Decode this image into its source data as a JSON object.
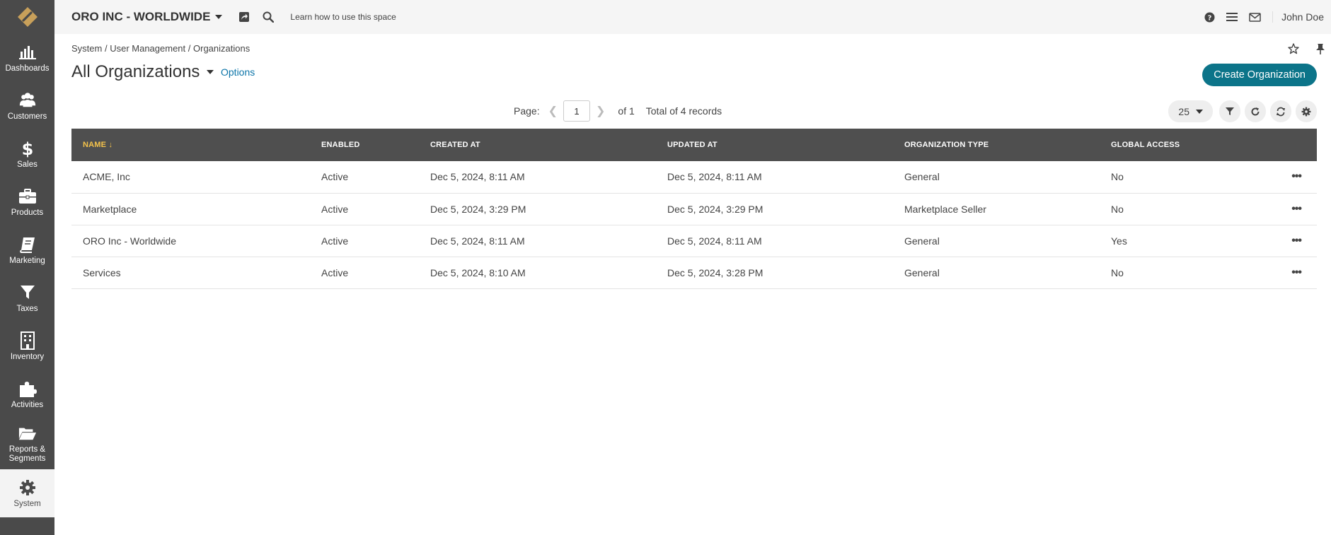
{
  "topbar": {
    "org_title": "ORO INC - WORLDWIDE",
    "learn_link": "Learn how to use this space",
    "user_name": "John Doe"
  },
  "sidebar": {
    "items": [
      {
        "label": "Dashboards",
        "icon": "bar-chart-icon"
      },
      {
        "label": "Customers",
        "icon": "users-icon"
      },
      {
        "label": "Sales",
        "icon": "dollar-icon"
      },
      {
        "label": "Products",
        "icon": "briefcase-icon"
      },
      {
        "label": "Marketing",
        "icon": "book-icon"
      },
      {
        "label": "Taxes",
        "icon": "filter-icon"
      },
      {
        "label": "Inventory",
        "icon": "building-icon"
      },
      {
        "label": "Activities",
        "icon": "puzzle-icon"
      },
      {
        "label": "Reports & Segments",
        "icon": "folder-open-icon"
      },
      {
        "label": "System",
        "icon": "gear-icon",
        "active": true
      }
    ]
  },
  "breadcrumb": [
    "System",
    "User Management",
    "Organizations"
  ],
  "page": {
    "title": "All Organizations",
    "options_label": "Options",
    "create_button": "Create Organization"
  },
  "pager": {
    "page_label": "Page:",
    "current_page": "1",
    "of_label": "of 1",
    "total_label": "Total of 4 records",
    "per_page": "25"
  },
  "table": {
    "columns": [
      "NAME",
      "ENABLED",
      "CREATED AT",
      "UPDATED AT",
      "ORGANIZATION TYPE",
      "GLOBAL ACCESS"
    ],
    "sorted_column": "NAME",
    "rows": [
      [
        "ACME, Inc",
        "Active",
        "Dec 5, 2024, 8:11 AM",
        "Dec 5, 2024, 8:11 AM",
        "General",
        "No"
      ],
      [
        "Marketplace",
        "Active",
        "Dec 5, 2024, 3:29 PM",
        "Dec 5, 2024, 3:29 PM",
        "Marketplace Seller",
        "No"
      ],
      [
        "ORO Inc - Worldwide",
        "Active",
        "Dec 5, 2024, 8:11 AM",
        "Dec 5, 2024, 8:11 AM",
        "General",
        "Yes"
      ],
      [
        "Services",
        "Active",
        "Dec 5, 2024, 8:10 AM",
        "Dec 5, 2024, 3:28 PM",
        "General",
        "No"
      ]
    ],
    "row_action": "•••"
  },
  "colors": {
    "sidebar_bg": "#4a4a4a",
    "accent": "#0c7489",
    "link": "#0b74a8",
    "header_bg": "#4f4f4f",
    "sorted_header": "#f5c34b",
    "logo": "#c8a05a"
  }
}
